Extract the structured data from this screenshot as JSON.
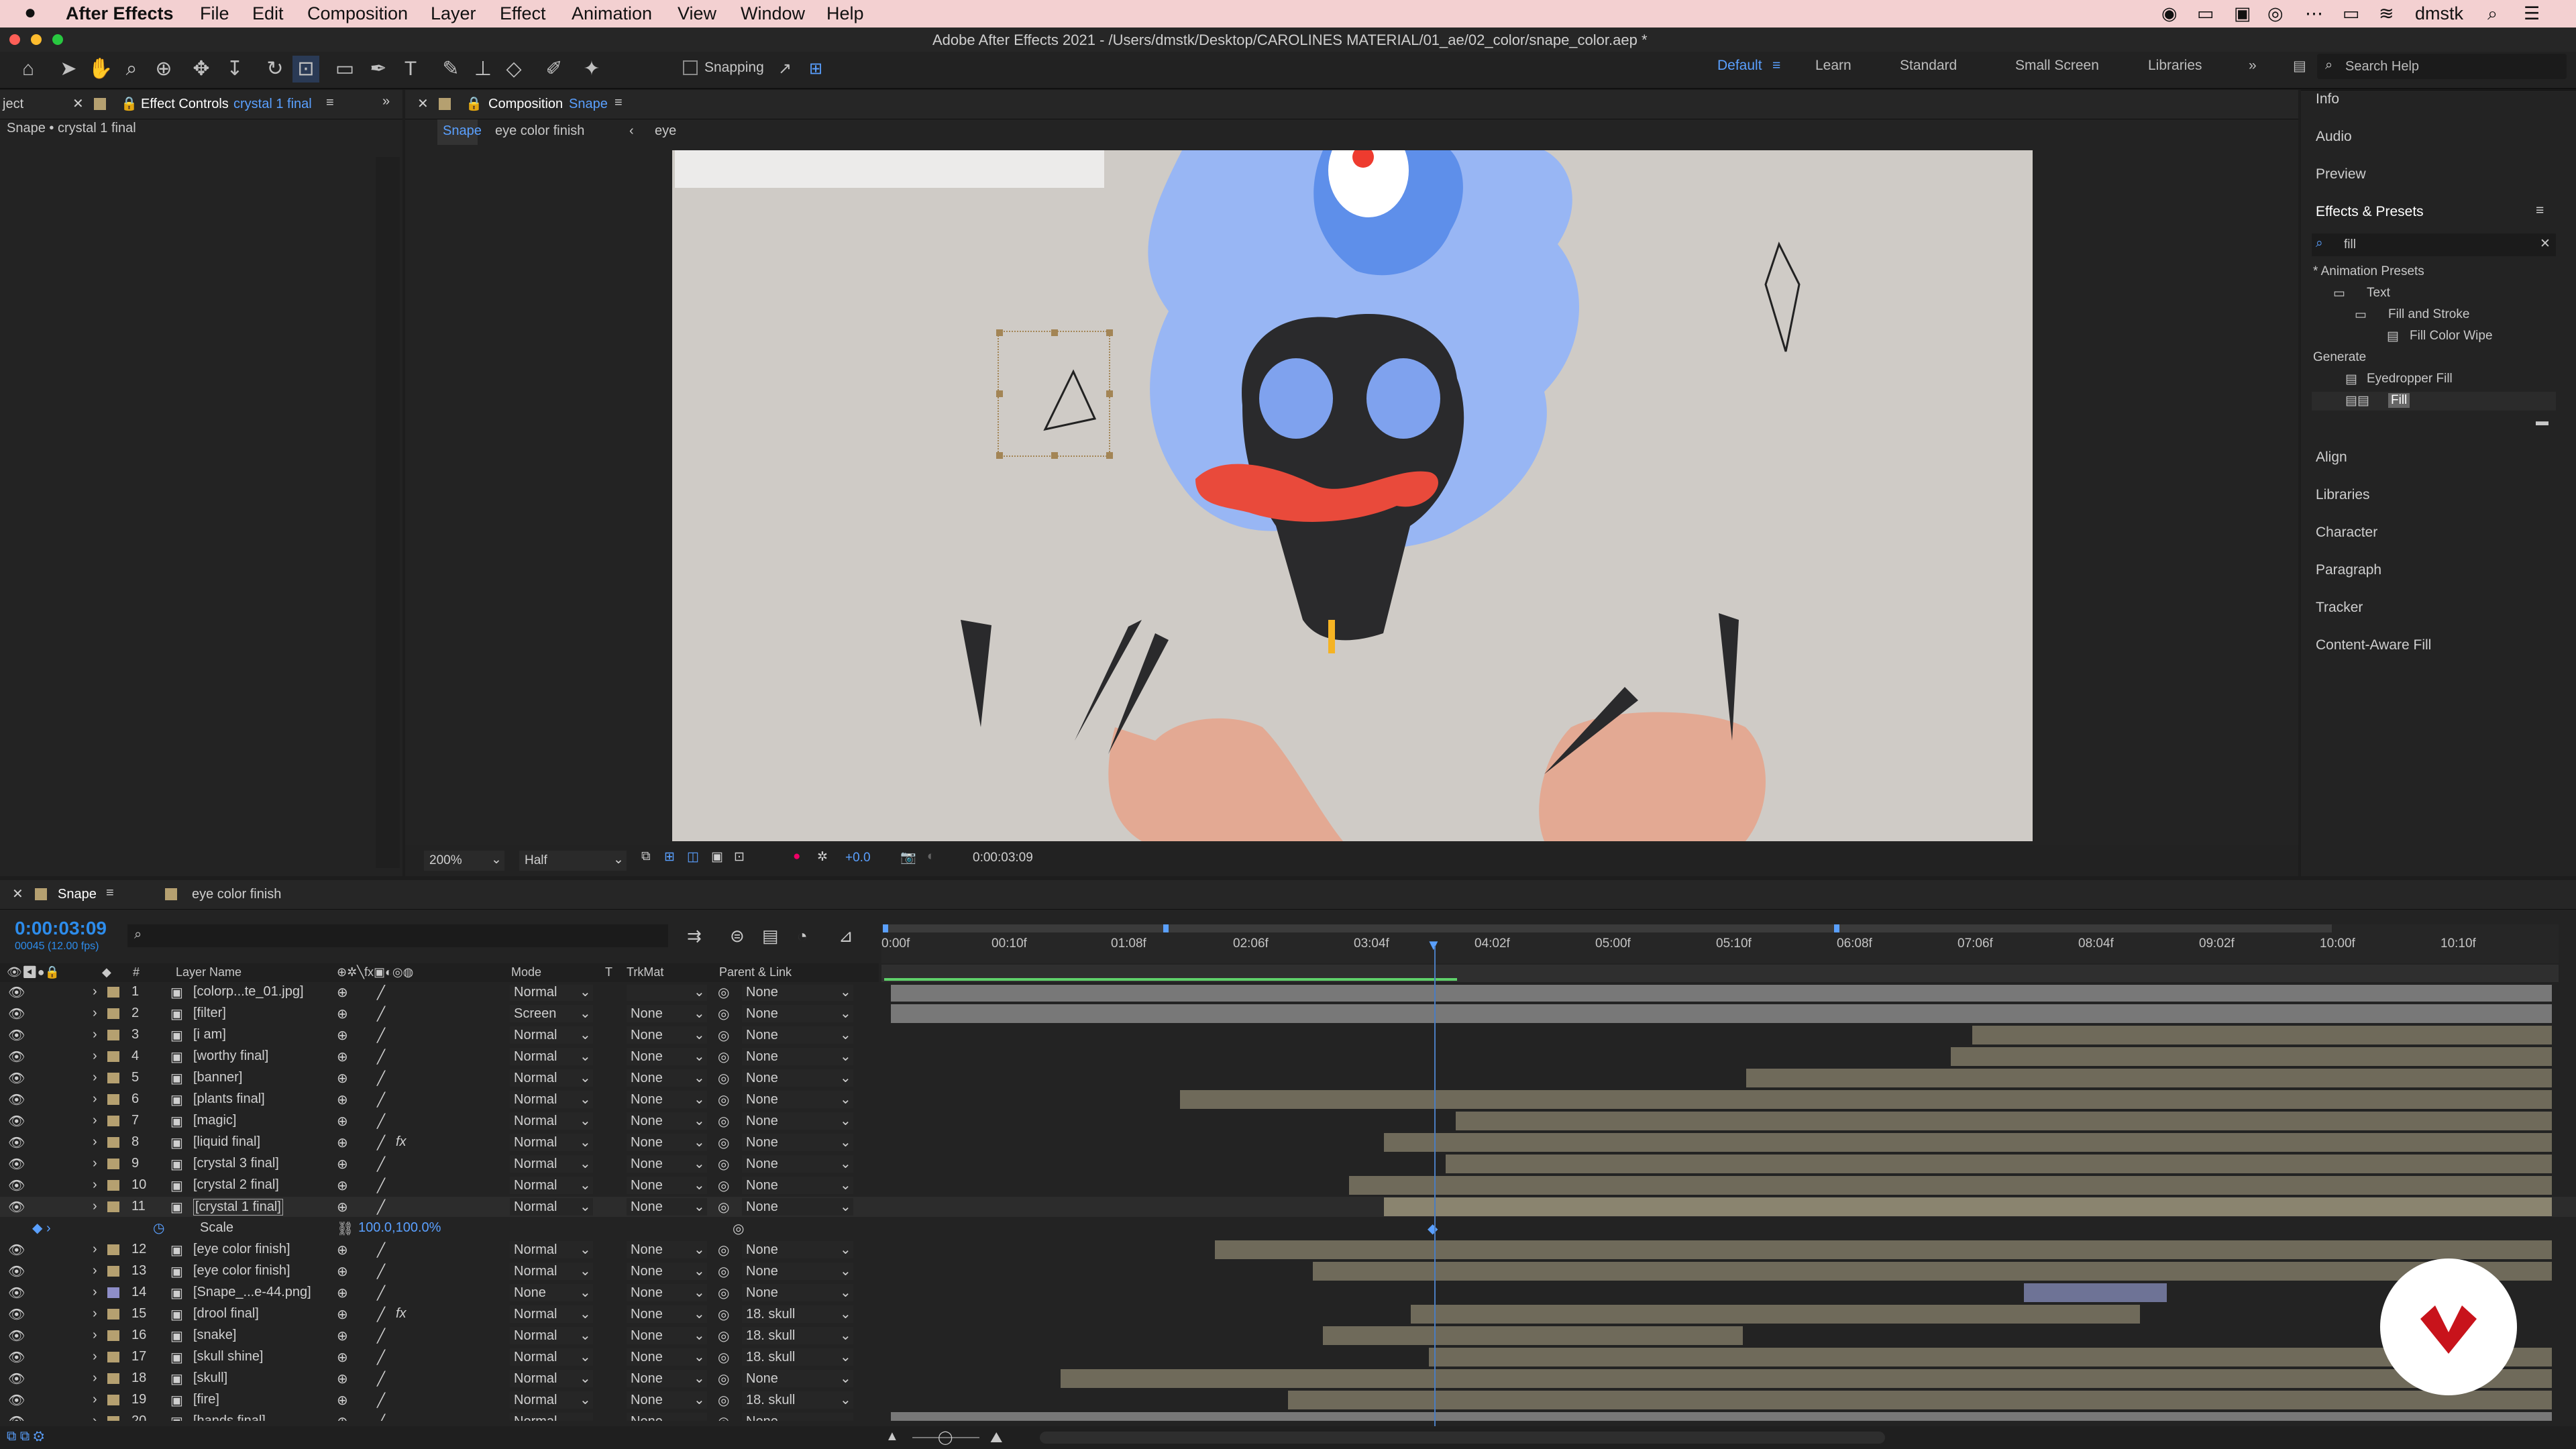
{
  "menubar": {
    "apple": "",
    "app": "After Effects",
    "items": [
      "File",
      "Edit",
      "Composition",
      "Layer",
      "Effect",
      "Animation",
      "View",
      "Window",
      "Help"
    ],
    "user": "dmstk"
  },
  "window_title": "Adobe After Effects 2021 - /Users/dmstk/Desktop/CAROLINES MATERIAL/01_ae/02_color/snape_color.aep *",
  "toolbar": {
    "snapping_label": "Snapping",
    "workspaces": [
      "Default",
      "Learn",
      "Standard",
      "Small Screen",
      "Libraries"
    ],
    "search_placeholder": "Search Help"
  },
  "effect_controls": {
    "tab_left": "ject",
    "tab_label": "Effect Controls",
    "tab_layer": "crystal 1 final",
    "breadcrumb": "Snape • crystal 1 final"
  },
  "composition": {
    "tab_label": "Composition",
    "tab_name": "Snape",
    "crumbs": [
      "Snape",
      "eye color finish",
      "eye"
    ],
    "zoom": "200%",
    "resolution": "Half",
    "exposure": "+0.0",
    "timecode": "0:00:03:09"
  },
  "right_panel": {
    "items_top": [
      "Info",
      "Audio",
      "Preview"
    ],
    "effects_title": "Effects & Presets",
    "search_value": "fill",
    "tree": [
      "* Animation Presets",
      "Text",
      "Fill and Stroke",
      "Fill Color Wipe",
      "Generate",
      "Eyedropper Fill",
      "Fill"
    ],
    "items_bottom": [
      "Align",
      "Libraries",
      "Character",
      "Paragraph",
      "Tracker",
      "Content-Aware Fill"
    ]
  },
  "timeline": {
    "tabs": [
      "Snape",
      "eye color finish"
    ],
    "timecode": "0:00:03:09",
    "frame_info": "00045 (12.00 fps)",
    "col_layer_name": "Layer Name",
    "col_mode": "Mode",
    "col_t": "T",
    "col_trkmat": "TrkMat",
    "col_parent": "Parent & Link",
    "ruler": [
      "0:00f",
      "00:10f",
      "01:08f",
      "02:06f",
      "03:04f",
      "04:02f",
      "05:00f",
      "05:10f",
      "06:08f",
      "07:06f",
      "08:04f",
      "09:02f",
      "10:00f",
      "10:10f"
    ],
    "layers": [
      {
        "num": "1",
        "name": "[colorp...te_01.jpg]",
        "mode": "Normal",
        "trk": "",
        "parent": "None",
        "fx": "",
        "bar_start": 0,
        "bar_end": 1
      },
      {
        "num": "2",
        "name": "[filter]",
        "mode": "Screen",
        "trk": "None",
        "parent": "None",
        "fx": "",
        "bar_start": 0,
        "bar_end": 1
      },
      {
        "num": "3",
        "name": "[i am]",
        "mode": "Normal",
        "trk": "None",
        "parent": "None",
        "fx": "",
        "bar_start": 0.651,
        "bar_end": 1
      },
      {
        "num": "4",
        "name": "[worthy final]",
        "mode": "Normal",
        "trk": "None",
        "parent": "None",
        "fx": "",
        "bar_start": 0.638,
        "bar_end": 1
      },
      {
        "num": "5",
        "name": "[banner]",
        "mode": "Normal",
        "trk": "None",
        "parent": "None",
        "fx": "",
        "bar_start": 0.515,
        "bar_end": 1
      },
      {
        "num": "6",
        "name": "[plants final]",
        "mode": "Normal",
        "trk": "None",
        "parent": "None",
        "fx": "",
        "bar_start": 0.174,
        "bar_end": 1
      },
      {
        "num": "7",
        "name": "[magic]",
        "mode": "Normal",
        "trk": "None",
        "parent": "None",
        "fx": "",
        "bar_start": 0.34,
        "bar_end": 1
      },
      {
        "num": "8",
        "name": "[liquid final]",
        "mode": "Normal",
        "trk": "None",
        "parent": "None",
        "fx": "fx",
        "bar_start": 0.297,
        "bar_end": 1
      },
      {
        "num": "9",
        "name": "[crystal 3 final]",
        "mode": "Normal",
        "trk": "None",
        "parent": "None",
        "fx": "",
        "bar_start": 0.334,
        "bar_end": 1
      },
      {
        "num": "10",
        "name": "[crystal 2 final]",
        "mode": "Normal",
        "trk": "None",
        "parent": "None",
        "fx": "",
        "bar_start": 0.276,
        "bar_end": 1
      },
      {
        "num": "11",
        "name": "[crystal 1 final]",
        "mode": "Normal",
        "trk": "None",
        "parent": "None",
        "fx": "",
        "bar_start": 0.297,
        "bar_end": 1
      },
      {
        "num": "12",
        "name": "[eye color finish]",
        "mode": "Normal",
        "trk": "None",
        "parent": "None",
        "fx": "",
        "bar_start": 0.195,
        "bar_end": 1
      },
      {
        "num": "13",
        "name": "[eye color finish]",
        "mode": "Normal",
        "trk": "None",
        "parent": "None",
        "fx": "",
        "bar_start": 0.254,
        "bar_end": 1
      },
      {
        "num": "14",
        "name": "[Snape_...e-44.png]",
        "mode": "None",
        "trk": "None",
        "parent": "None",
        "fx": "",
        "bar_start": 0.682,
        "bar_end": 0.768
      },
      {
        "num": "15",
        "name": "[drool final]",
        "mode": "Normal",
        "trk": "None",
        "parent": "18. skull",
        "fx": "fx",
        "bar_start": 0.313,
        "bar_end": 0.752
      },
      {
        "num": "16",
        "name": "[snake]",
        "mode": "Normal",
        "trk": "None",
        "parent": "18. skull",
        "fx": "",
        "bar_start": 0.26,
        "bar_end": 0.513
      },
      {
        "num": "17",
        "name": "[skull shine]",
        "mode": "Normal",
        "trk": "None",
        "parent": "18. skull",
        "fx": "",
        "bar_start": 0.324,
        "bar_end": 1
      },
      {
        "num": "18",
        "name": "[skull]",
        "mode": "Normal",
        "trk": "None",
        "parent": "None",
        "fx": "",
        "bar_start": 0.102,
        "bar_end": 1
      },
      {
        "num": "19",
        "name": "[fire]",
        "mode": "Normal",
        "trk": "None",
        "parent": "18. skull",
        "fx": "",
        "bar_start": 0.239,
        "bar_end": 1
      },
      {
        "num": "20",
        "name": "[hands final]",
        "mode": "Normal",
        "trk": "None",
        "parent": "None",
        "fx": "",
        "bar_start": 0,
        "bar_end": 1
      }
    ],
    "scale_label": "Scale",
    "scale_value": "100.0,100.0%"
  },
  "colors": {
    "accent": "#2d8ceb",
    "timecode": "#2d8ceb",
    "menubar": "#f3d0d1",
    "bar": "#6f6a5a",
    "selected_bar": "#8a846f"
  }
}
